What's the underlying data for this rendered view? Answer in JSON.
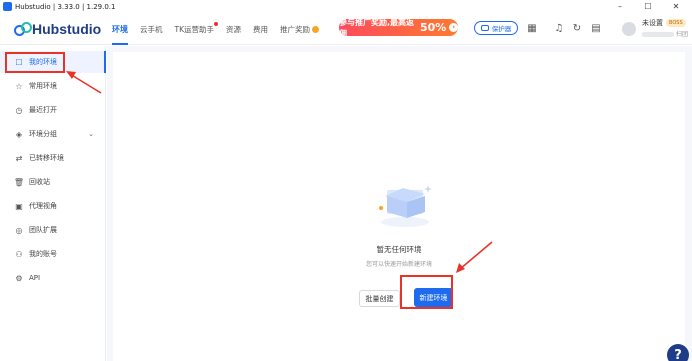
{
  "window": {
    "title": "Hubstudio | 3.33.0 | 1.29.0.1",
    "controls": [
      "–",
      "☐",
      "✕"
    ]
  },
  "header": {
    "brand": "Hubstudio",
    "tabs": [
      {
        "label": "环境",
        "active": true
      },
      {
        "label": "云手机"
      },
      {
        "label": "TK运营助手",
        "dot": true
      },
      {
        "label": "资源"
      },
      {
        "label": "费用"
      },
      {
        "label": "推广奖励",
        "coin": true
      }
    ],
    "promo": {
      "text": "参与推广奖励,最高返佣",
      "percent": "50%",
      "arrow": "›"
    },
    "assistant_label": "保护器",
    "user": {
      "name": "未设置",
      "badge": "BOSS",
      "id_suffix": "扫团"
    }
  },
  "sidebar": {
    "items": [
      {
        "label": "我的环境",
        "icon": "☐",
        "active": true
      },
      {
        "label": "常用环境",
        "icon": "☆"
      },
      {
        "label": "最近打开",
        "icon": "◷"
      },
      {
        "label": "环境分组",
        "icon": "◈",
        "chevron": "⌄"
      },
      {
        "label": "已转移环境",
        "icon": "⇄"
      },
      {
        "label": "回收站",
        "icon": "🗑"
      },
      {
        "label": "代理视角",
        "icon": "▣"
      },
      {
        "label": "团队扩展",
        "icon": "◎"
      },
      {
        "label": "我的账号",
        "icon": "⚇"
      },
      {
        "label": "API",
        "icon": "⚙"
      }
    ]
  },
  "main": {
    "empty_title": "暂无任何环境",
    "empty_subtitle": "您可以快速开始新建环境",
    "batch_create_label": "批量创建",
    "new_env_label": "新建环境"
  },
  "help_label": "?",
  "colors": {
    "accent": "#1f6bf0",
    "annotation": "#e8332a",
    "promo": "#ff4a5e"
  }
}
